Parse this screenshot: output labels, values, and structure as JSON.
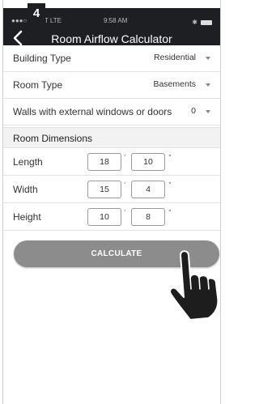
{
  "status": {
    "carrier": "●●●○○ AT&T LTE",
    "time": "9:58 AM",
    "bluetooth": "✱"
  },
  "step": "4",
  "nav": {
    "title": "Room Airflow Calculator"
  },
  "fields": [
    {
      "label": "Building Type",
      "value": "Residential"
    },
    {
      "label": "Room Type",
      "value": "Basements"
    },
    {
      "label": "Walls with external windows or doors",
      "value": "0"
    }
  ],
  "section": {
    "title": "Room Dimensions"
  },
  "dimensions": [
    {
      "label": "Length",
      "feet": "18",
      "inches": "10"
    },
    {
      "label": "Width",
      "feet": "15",
      "inches": "4"
    },
    {
      "label": "Height",
      "feet": "10",
      "inches": "8"
    }
  ],
  "units": {
    "feet": "′",
    "inches": "″"
  },
  "actions": {
    "calculate": "CALCULATE"
  },
  "colors": {
    "navbar": "#1d1f23",
    "button": "#8c8c8c",
    "section": "#f2f2f2"
  },
  "icons": {
    "back": "chevron-left-icon",
    "hand": "pointing-hand-icon",
    "dropdown": "caret-down-icon"
  }
}
